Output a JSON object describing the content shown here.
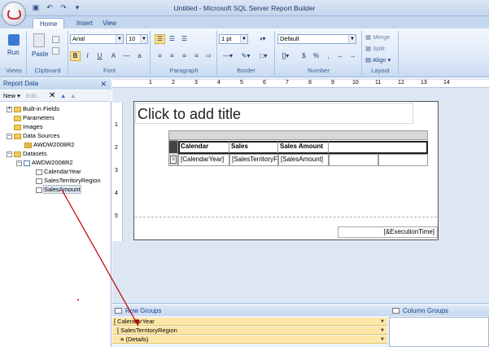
{
  "window": {
    "title": "Untitled - Microsoft SQL Server Report Builder"
  },
  "qat": {
    "save_icon": "save-icon",
    "undo_icon": "undo-icon",
    "redo_icon": "redo-icon",
    "more_icon": "chevron-down-icon"
  },
  "tabs": [
    "Home",
    "Insert",
    "View"
  ],
  "ribbon": {
    "groups": [
      "Views",
      "Clipboard",
      "Font",
      "Paragraph",
      "Border",
      "Number",
      "Layout"
    ],
    "run_label": "Run",
    "paste_label": "Paste",
    "font_name": "Arial",
    "font_size": "10",
    "border_width": "1 pt",
    "number_format": "Default",
    "merge_label": "Merge",
    "split_label": "Split",
    "align_label": "Align",
    "bold": "B",
    "italic": "I",
    "underline": "U",
    "currency": "$",
    "percent": "%",
    "comma": ","
  },
  "report_data": {
    "title": "Report Data",
    "new_label": "New",
    "edit_label": "Edit...",
    "tree": {
      "builtin_fields": "Built-in Fields",
      "parameters": "Parameters",
      "images": "Images",
      "data_sources": "Data Sources",
      "data_source_1": "AWDW2008R2",
      "datasets": "Datasets",
      "dataset_1": "AWDW2008R2",
      "field_1": "CalendarYear",
      "field_2": "SalesTerritoryRegion",
      "field_3": "SalesAmount"
    }
  },
  "ruler": {
    "ticks": [
      "1",
      "2",
      "3",
      "4",
      "5",
      "6",
      "7",
      "8",
      "9",
      "10",
      "11",
      "12",
      "13",
      "14"
    ],
    "v_ticks": [
      "1",
      "2",
      "3",
      "4",
      "5"
    ]
  },
  "report": {
    "title_placeholder": "Click to add title",
    "header_1": "Calendar",
    "header_2": "Sales",
    "header_3": "Sales Amount",
    "cell_1": "[CalendarYear]",
    "cell_2": "[SalesTerritoryF",
    "cell_3": "[SalesAmount]",
    "footer_expr": "[&ExecutionTime]"
  },
  "groups": {
    "row_groups_label": "Row Groups",
    "column_groups_label": "Column Groups",
    "row_1": "[ CalendarYear",
    "row_2": "[ SalesTerritoryRegion",
    "row_3": "≡ (Details)"
  },
  "colors": {
    "accent": "#15428b",
    "ribbon": "#dbe7f7",
    "group_row": "#fde7a8",
    "drag_line": "#c00000"
  }
}
